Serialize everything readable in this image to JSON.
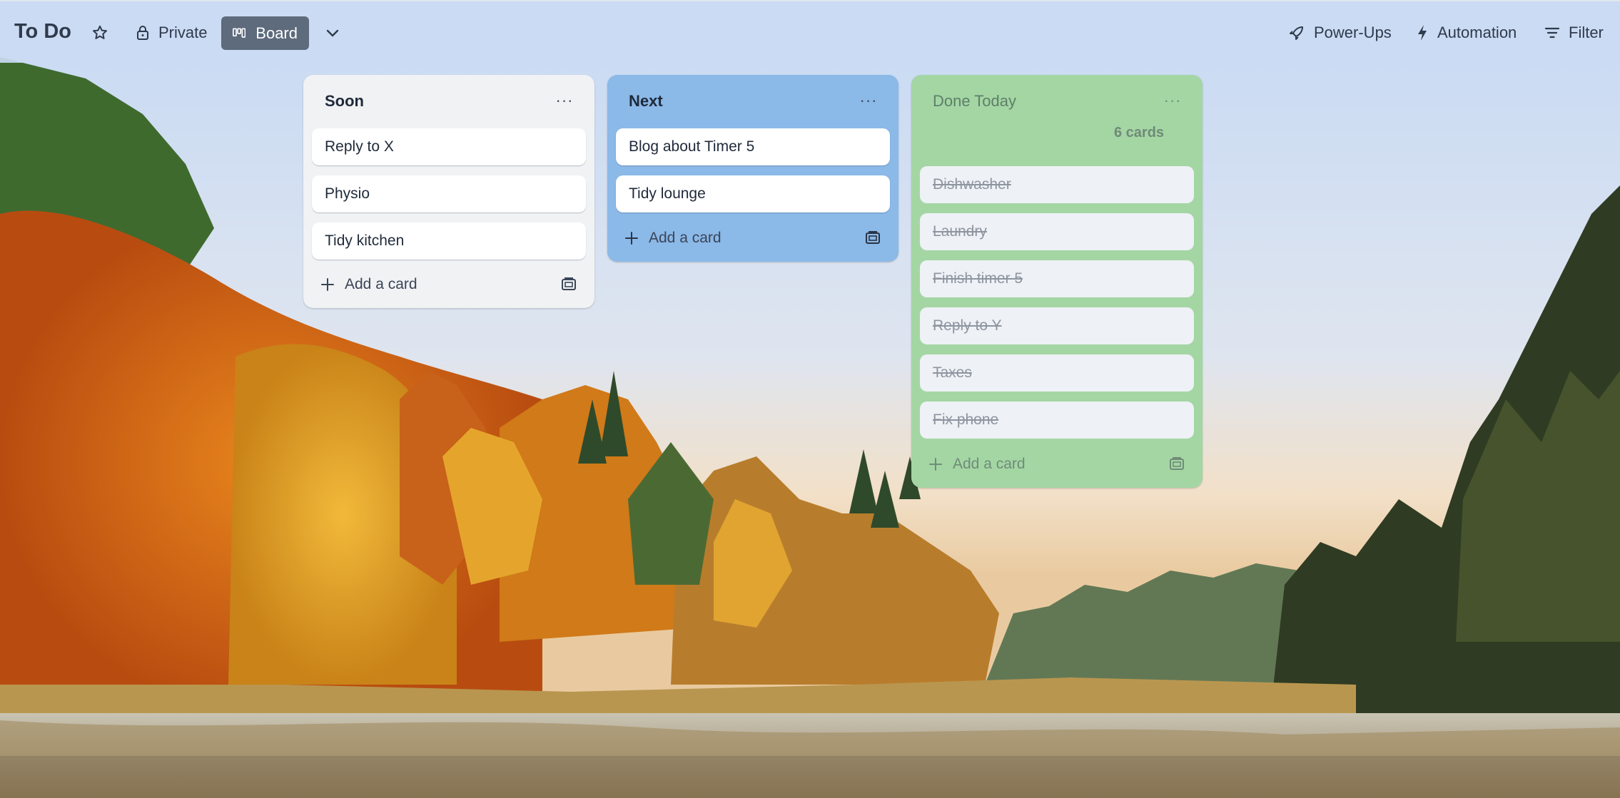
{
  "header": {
    "board_title": "To Do",
    "star_icon": "star-icon",
    "visibility_label": "Private",
    "view_label": "Board",
    "powerups_label": "Power-Ups",
    "automation_label": "Automation",
    "filter_label": "Filter"
  },
  "lists": [
    {
      "title": "Soon",
      "cards": [
        "Reply to X",
        "Physio",
        "Tidy kitchen"
      ],
      "add_card_label": "Add a card"
    },
    {
      "title": "Next",
      "cards": [
        "Blog about Timer 5",
        "Tidy lounge"
      ],
      "add_card_label": "Add a card"
    },
    {
      "title": "Done Today",
      "card_count": "6 cards",
      "cards": [
        "Dishwasher",
        "Laundry",
        "Finish timer 5",
        "Reply to Y",
        "Taxes",
        "Fix phone"
      ],
      "add_card_label": "Add a card"
    }
  ],
  "colors": {
    "header_bg": "#cbdbf3",
    "board_button_bg": "#5e6b7d",
    "soon_list_bg": "#f1f2f4",
    "next_list_bg": "#8bb9e8",
    "done_list_bg": "#a4d6a4"
  }
}
